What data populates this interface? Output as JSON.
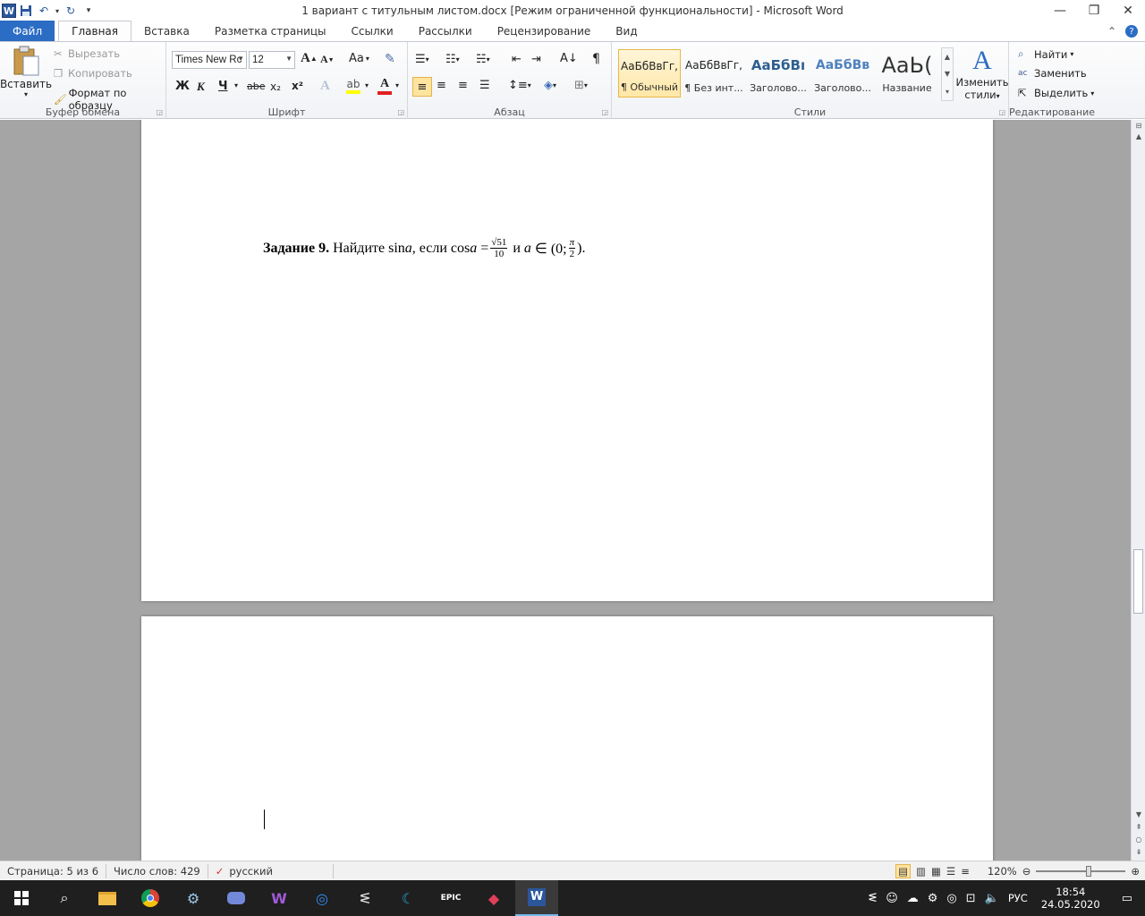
{
  "window": {
    "title": "1  вариант с титульным листом.docx [Режим ограниченной функциональности]  -  Microsoft Word",
    "app_icon": "W"
  },
  "tabs": [
    "Файл",
    "Главная",
    "Вставка",
    "Разметка страницы",
    "Ссылки",
    "Рассылки",
    "Рецензирование",
    "Вид"
  ],
  "clipboard": {
    "paste": "Вставить",
    "cut": "Вырезать",
    "copy": "Копировать",
    "format_painter": "Формат по образцу",
    "label": "Буфер обмена"
  },
  "font": {
    "family": "Times New Rc",
    "size": "12",
    "label": "Шрифт",
    "grow": "A",
    "shrink": "A",
    "case": "Aa",
    "bold": "Ж",
    "italic": "К",
    "underline": "Ч",
    "strike": "abe",
    "sub": "x₂",
    "sup": "x²",
    "effects": "A",
    "color": "A"
  },
  "paragraph": {
    "label": "Абзац",
    "show_marks": "¶"
  },
  "styles": {
    "label": "Стили",
    "items": [
      {
        "preview": "АаБбВвГг,",
        "name": "¶ Обычный"
      },
      {
        "preview": "АаБбВвГг,",
        "name": "¶ Без инт..."
      },
      {
        "preview": "АаБбВı",
        "name": "Заголово..."
      },
      {
        "preview": "АаБбВв",
        "name": "Заголово..."
      },
      {
        "preview": "АаЬ(",
        "name": "Название"
      }
    ],
    "change": "Изменить",
    "change2": "стили"
  },
  "editing": {
    "label": "Редактирование",
    "find": "Найти",
    "replace": "Заменить",
    "select": "Выделить"
  },
  "document": {
    "task_bold": "Задание 9.",
    "task_text1": " Найдите sin",
    "task_var": "a",
    "task_text2": ", если cos",
    "task_eq": " =",
    "frac_num": "√51",
    "frac_den": "10",
    "task_text3": " и ",
    "task_in": " ∈ (0;",
    "frac2_num": "π",
    "frac2_den": "2",
    "task_end": ")."
  },
  "status": {
    "page": "Страница: 5 из 6",
    "words": "Число слов: 429",
    "lang": "русский",
    "zoom": "120%"
  },
  "tray": {
    "lang": "РУС",
    "time": "18:54",
    "date": "24.05.2020"
  }
}
